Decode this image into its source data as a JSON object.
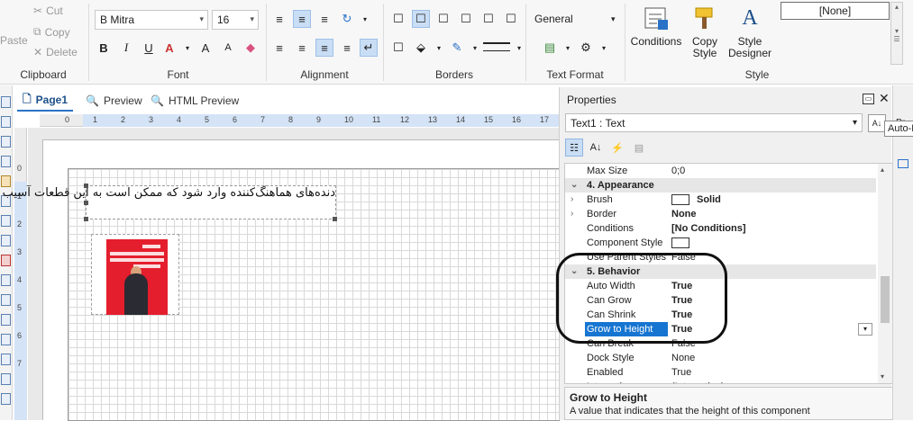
{
  "ribbon": {
    "clipboard": {
      "label": "Clipboard",
      "paste": "Paste",
      "cut": "Cut",
      "copy": "Copy",
      "delete": "Delete"
    },
    "font": {
      "label": "Font",
      "family": "B Mitra",
      "size": "16",
      "bold": "B",
      "italic": "I",
      "underline": "U",
      "grow": "A",
      "shrink": "A"
    },
    "alignment": {
      "label": "Alignment"
    },
    "borders": {
      "label": "Borders"
    },
    "text_format": {
      "label": "Text Format",
      "format": "General"
    },
    "style": {
      "label": "Style",
      "conditions": "Conditions",
      "copy_style_1": "Copy",
      "copy_style_2": "Style",
      "style_designer_1": "Style",
      "style_designer_2": "Designer",
      "style_value": "[None]"
    }
  },
  "tabs": [
    {
      "label": "Page1"
    },
    {
      "label": "Preview"
    },
    {
      "label": "HTML Preview"
    }
  ],
  "ruler_h": [
    "0",
    "1",
    "2",
    "3",
    "4",
    "5",
    "6",
    "7",
    "8",
    "9",
    "10",
    "11",
    "12",
    "13",
    "14",
    "15",
    "16",
    "17"
  ],
  "ruler_v": [
    "0",
    "1",
    "2",
    "3",
    "4",
    "5",
    "6",
    "7"
  ],
  "canvas": {
    "text_value": "دنده‌های هماهنگ‌کننده وارد شود که ممکن است به این قطعات آسیب برساند"
  },
  "properties": {
    "title": "Properties",
    "object": "Text1 : Text",
    "rows": [
      {
        "name": "Max Size",
        "value": "0;0",
        "type": "plain"
      },
      {
        "name": "4. Appearance",
        "value": "",
        "type": "cat"
      },
      {
        "name": "Brush",
        "value": "Solid",
        "type": "swatch",
        "expand": "›"
      },
      {
        "name": "Border",
        "value": "None",
        "type": "bold",
        "expand": "›"
      },
      {
        "name": "Conditions",
        "value": "[No Conditions]",
        "type": "bold"
      },
      {
        "name": "Component Style",
        "value": "",
        "type": "swatchonly"
      },
      {
        "name": "Use Parent Styles",
        "value": "False",
        "type": "plain"
      },
      {
        "name": "5. Behavior",
        "value": "",
        "type": "cat"
      },
      {
        "name": "Auto Width",
        "value": "True",
        "type": "bold"
      },
      {
        "name": "Can Grow",
        "value": "True",
        "type": "bold"
      },
      {
        "name": "Can Shrink",
        "value": "True",
        "type": "bold"
      },
      {
        "name": "Grow to Height",
        "value": "True",
        "type": "selected"
      },
      {
        "name": "Can Break",
        "value": "False",
        "type": "plain"
      },
      {
        "name": "Dock Style",
        "value": "None",
        "type": "plain"
      },
      {
        "name": "Enabled",
        "value": "True",
        "type": "plain"
      },
      {
        "name": "Interaction",
        "value": "(Interaction)",
        "type": "plain"
      }
    ],
    "description_title": "Grow to Height",
    "description_text": "A value that indicates that the height of this component"
  },
  "tooltip": "Auto-H",
  "right_bar": {
    "label": "Pr"
  }
}
